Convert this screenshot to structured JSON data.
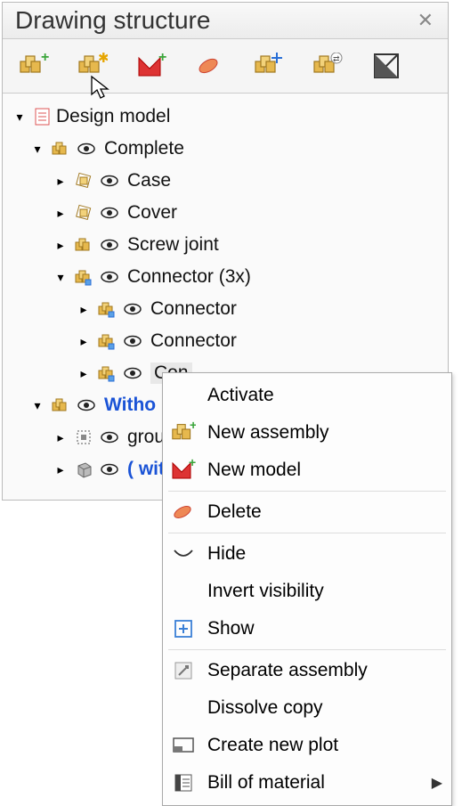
{
  "panel": {
    "title": "Drawing structure"
  },
  "toolbar": {
    "btns": [
      {
        "name": "new-assembly-icon"
      },
      {
        "name": "new-item-icon"
      },
      {
        "name": "new-model-icon"
      },
      {
        "name": "delete-icon"
      },
      {
        "name": "move-icon"
      },
      {
        "name": "settings-icon"
      },
      {
        "name": "display-mode-icon"
      }
    ]
  },
  "tree": {
    "root": {
      "label": "Design model"
    },
    "complete": {
      "label": "Complete"
    },
    "case": {
      "label": "Case"
    },
    "cover": {
      "label": "Cover"
    },
    "screw": {
      "label": "Screw joint"
    },
    "connector_group": {
      "label": "Connector (3x)"
    },
    "connector1": {
      "label": "Connector"
    },
    "connector2": {
      "label": "Connector"
    },
    "connector3": {
      "label": "Con"
    },
    "without": {
      "label": "Witho"
    },
    "group": {
      "label": "grou"
    },
    "without2": {
      "label": "( wit"
    }
  },
  "ctx": {
    "activate": "Activate",
    "new_assembly": "New assembly",
    "new_model": "New model",
    "delete": "Delete",
    "hide": "Hide",
    "invert": "Invert visibility",
    "show": "Show",
    "separate": "Separate assembly",
    "dissolve": "Dissolve copy",
    "plot": "Create new plot",
    "bom": "Bill of material"
  }
}
